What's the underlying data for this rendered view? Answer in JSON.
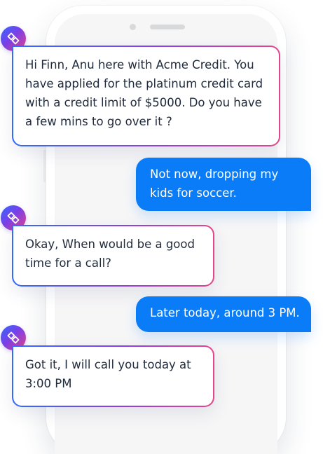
{
  "phone": {
    "screen_background": "#f6f6f7"
  },
  "bot": {
    "avatar_icon": "diamond-link-logo-icon",
    "avatar_gradient": [
      "#2f6bff",
      "#7a3fe8",
      "#e6458a"
    ]
  },
  "colors": {
    "outgoing_bubble": "#0a7cf7",
    "incoming_text": "#1f2a3c",
    "incoming_border_gradient": [
      "#2f6bff",
      "#8d3fe0",
      "#e6458a"
    ]
  },
  "messages": [
    {
      "direction": "incoming",
      "text": "Hi Finn, Anu here with Acme Credit. You have applied for the platinum credit card with a credit limit of $5000. Do you have a few mins to go over it ?"
    },
    {
      "direction": "outgoing",
      "text": "Not now, dropping my kids for soccer."
    },
    {
      "direction": "incoming",
      "text": "Okay, When would be a good time for a call?"
    },
    {
      "direction": "outgoing",
      "text": "Later today, around 3 PM."
    },
    {
      "direction": "incoming",
      "text": "Got it, I will call you today at 3:00 PM"
    }
  ]
}
